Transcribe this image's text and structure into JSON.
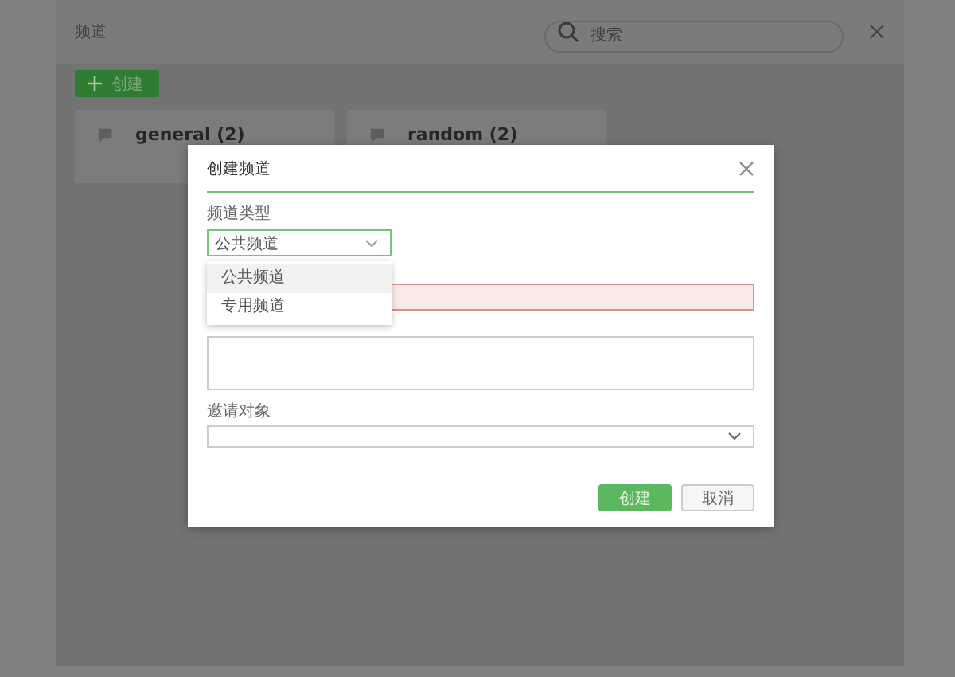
{
  "header": {
    "title": "频道",
    "search": {
      "placeholder": "搜索"
    }
  },
  "create_button": {
    "label": "创建"
  },
  "channels": [
    {
      "name": "general",
      "count": "(2)"
    },
    {
      "name": "random",
      "count": "(2)"
    }
  ],
  "dialog": {
    "title": "创建频道",
    "type_field": {
      "label": "频道类型",
      "value": "公共频道",
      "expanded": true,
      "options": [
        {
          "label": "公共频道",
          "selected": true
        },
        {
          "label": "专用频道",
          "selected": false
        }
      ]
    },
    "name_field": {
      "error": true
    },
    "invite_field": {
      "label": "邀请对象"
    },
    "buttons": [
      {
        "label": "创建",
        "kind": "primary"
      },
      {
        "label": "取消",
        "kind": "secondary"
      }
    ]
  }
}
